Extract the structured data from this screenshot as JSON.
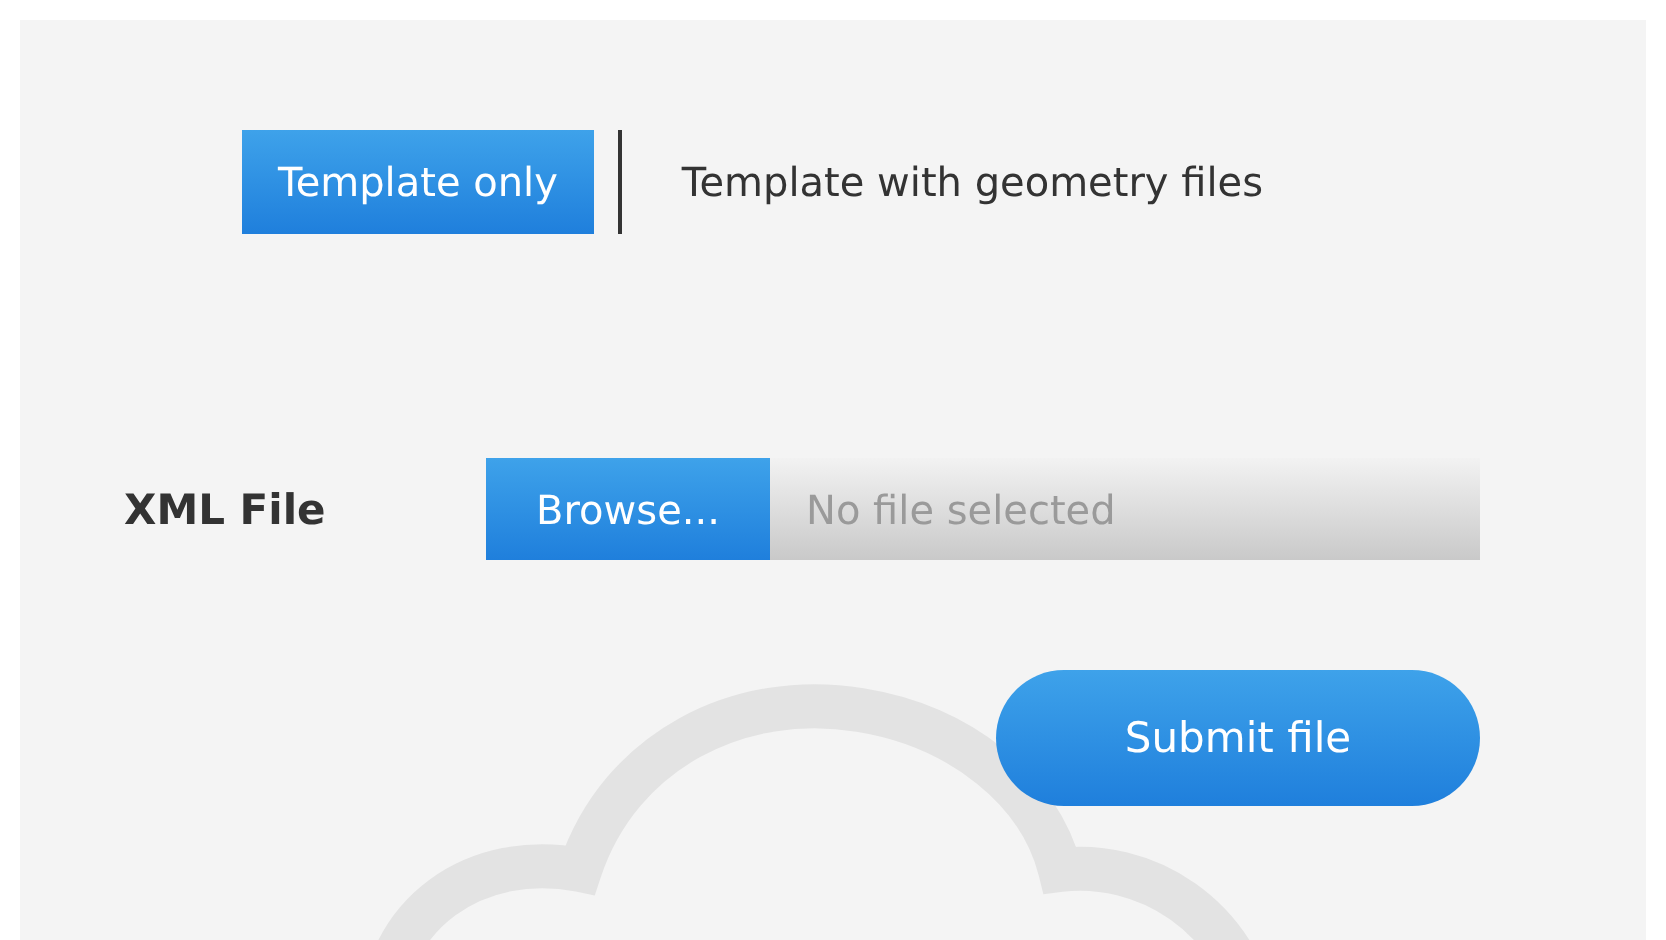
{
  "mode_tabs": [
    {
      "label": "Template only",
      "selected": true
    },
    {
      "label": "Template with geometry files",
      "selected": false
    }
  ],
  "xml_file": {
    "label": "XML File",
    "browse_button": "Browse...",
    "placeholder": "No file selected"
  },
  "submit_button": "Submit file"
}
